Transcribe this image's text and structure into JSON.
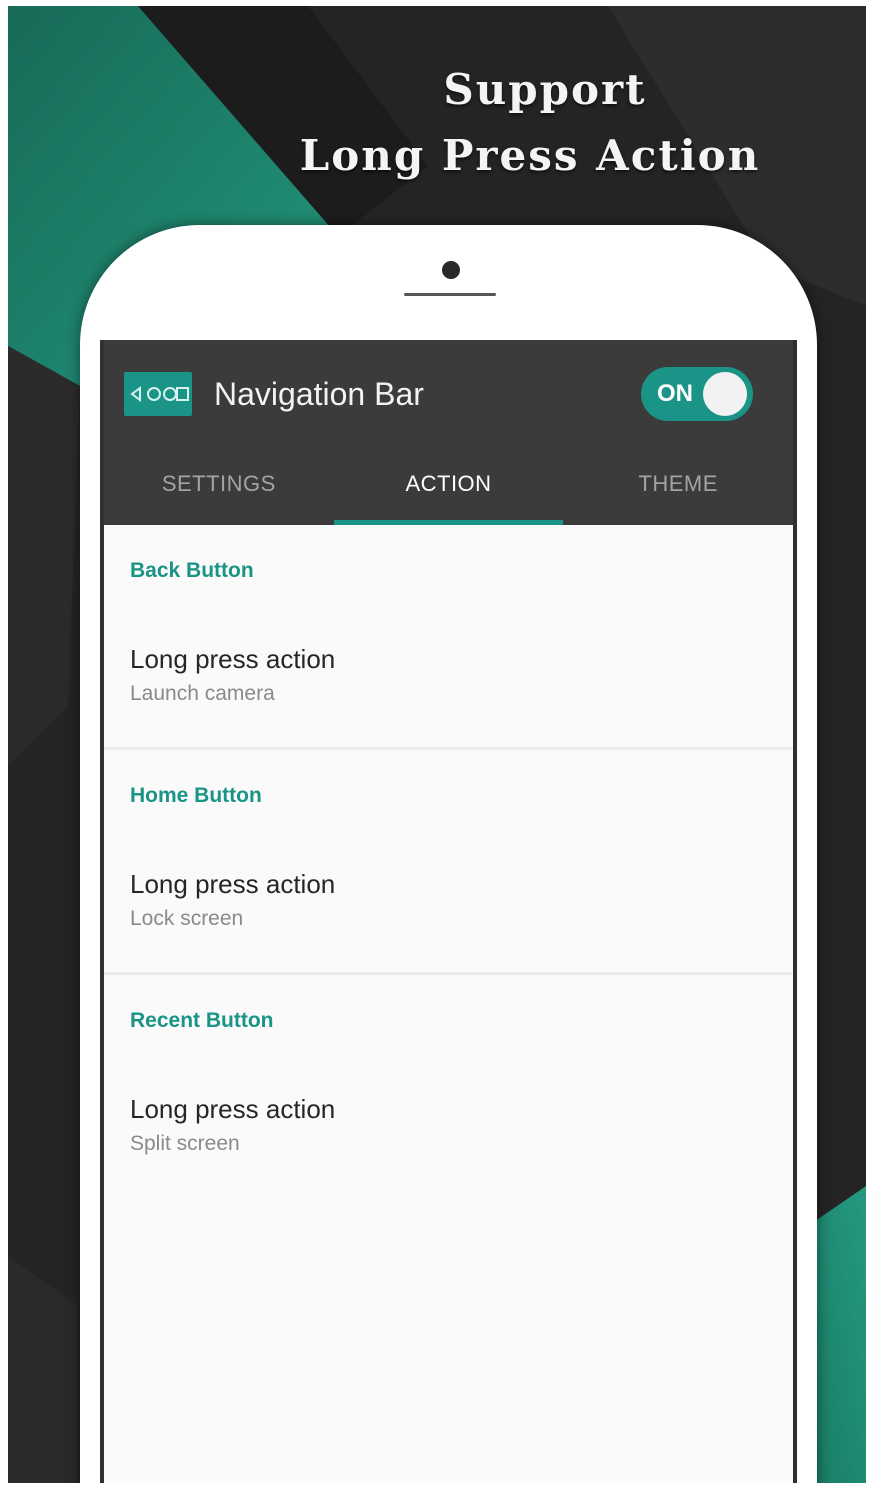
{
  "headline": {
    "line1": "Support",
    "line2": "Long Press Action"
  },
  "app": {
    "title": "Navigation Bar",
    "toggle_label": "ON",
    "icon": "nav-bar-icon"
  },
  "tabs": [
    {
      "label": "SETTINGS",
      "active": false
    },
    {
      "label": "ACTION",
      "active": true
    },
    {
      "label": "THEME",
      "active": false
    }
  ],
  "sections": [
    {
      "header": "Back Button",
      "item_title": "Long press action",
      "item_value": "Launch camera"
    },
    {
      "header": "Home Button",
      "item_title": "Long press action",
      "item_value": "Lock screen"
    },
    {
      "header": "Recent Button",
      "item_title": "Long press action",
      "item_value": "Split screen"
    }
  ],
  "colors": {
    "accent": "#1a9486",
    "appbar": "#3b3b3b",
    "background_dark": "#242424",
    "background_green": "#1e8a72"
  }
}
